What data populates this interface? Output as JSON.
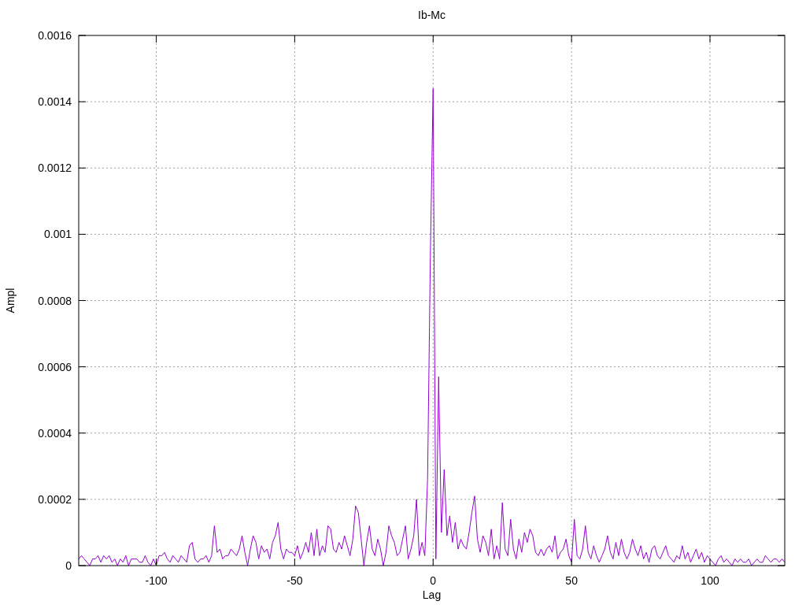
{
  "chart_data": {
    "type": "line",
    "grid": true,
    "title": "Ib-Mc",
    "xlabel": "Lag",
    "ylabel": "Ampl",
    "xlim": [
      -128,
      127
    ],
    "ylim": [
      0,
      0.0016
    ],
    "xticks": [
      -100,
      -50,
      0,
      50,
      100
    ],
    "yticks": [
      0,
      0.0002,
      0.0004,
      0.0006,
      0.0008,
      0.001,
      0.0012,
      0.0014,
      0.0016
    ],
    "x": [
      -128,
      -127,
      -126,
      -125,
      -124,
      -123,
      -122,
      -121,
      -120,
      -119,
      -118,
      -117,
      -116,
      -115,
      -114,
      -113,
      -112,
      -111,
      -110,
      -109,
      -108,
      -107,
      -106,
      -105,
      -104,
      -103,
      -102,
      -101,
      -100,
      -99,
      -98,
      -97,
      -96,
      -95,
      -94,
      -93,
      -92,
      -91,
      -90,
      -89,
      -88,
      -87,
      -86,
      -85,
      -84,
      -83,
      -82,
      -81,
      -80,
      -79,
      -78,
      -77,
      -76,
      -75,
      -74,
      -73,
      -72,
      -71,
      -70,
      -69,
      -68,
      -67,
      -66,
      -65,
      -64,
      -63,
      -62,
      -61,
      -60,
      -59,
      -58,
      -57,
      -56,
      -55,
      -54,
      -53,
      -52,
      -51,
      -50,
      -49,
      -48,
      -47,
      -46,
      -45,
      -44,
      -43,
      -42,
      -41,
      -40,
      -39,
      -38,
      -37,
      -36,
      -35,
      -34,
      -33,
      -32,
      -31,
      -30,
      -29,
      -28,
      -27,
      -26,
      -25,
      -24,
      -23,
      -22,
      -21,
      -20,
      -19,
      -18,
      -17,
      -16,
      -15,
      -14,
      -13,
      -12,
      -11,
      -10,
      -9,
      -8,
      -7,
      -6,
      -5,
      -4,
      -3,
      -2,
      -1,
      0,
      1,
      2,
      3,
      4,
      5,
      6,
      7,
      8,
      9,
      10,
      11,
      12,
      13,
      14,
      15,
      16,
      17,
      18,
      19,
      20,
      21,
      22,
      23,
      24,
      25,
      26,
      27,
      28,
      29,
      30,
      31,
      32,
      33,
      34,
      35,
      36,
      37,
      38,
      39,
      40,
      41,
      42,
      43,
      44,
      45,
      46,
      47,
      48,
      49,
      50,
      51,
      52,
      53,
      54,
      55,
      56,
      57,
      58,
      59,
      60,
      61,
      62,
      63,
      64,
      65,
      66,
      67,
      68,
      69,
      70,
      71,
      72,
      73,
      74,
      75,
      76,
      77,
      78,
      79,
      80,
      81,
      82,
      83,
      84,
      85,
      86,
      87,
      88,
      89,
      90,
      91,
      92,
      93,
      94,
      95,
      96,
      97,
      98,
      99,
      100,
      101,
      102,
      103,
      104,
      105,
      106,
      107,
      108,
      109,
      110,
      111,
      112,
      113,
      114,
      115,
      116,
      117,
      118,
      119,
      120,
      121,
      122,
      123,
      124,
      125,
      126,
      127
    ],
    "series": [
      {
        "color": "#9400d3",
        "values": [
          2e-05,
          3e-05,
          2e-05,
          1e-05,
          0,
          2e-05,
          2e-05,
          3e-05,
          1e-05,
          3e-05,
          2e-05,
          3e-05,
          1e-05,
          2e-05,
          0,
          2e-05,
          1e-05,
          3e-05,
          0,
          2e-05,
          2e-05,
          2e-05,
          1e-05,
          1e-05,
          3e-05,
          1e-05,
          0,
          2e-05,
          0,
          3e-05,
          3e-05,
          4e-05,
          2e-05,
          1e-05,
          3e-05,
          2e-05,
          1e-05,
          3e-05,
          2e-05,
          1e-05,
          6e-05,
          7e-05,
          2e-05,
          1e-05,
          2e-05,
          2e-05,
          3e-05,
          1e-05,
          3e-05,
          0.00012,
          4e-05,
          5e-05,
          2e-05,
          3e-05,
          3e-05,
          5e-05,
          4e-05,
          3e-05,
          5e-05,
          9e-05,
          4e-05,
          0,
          5e-05,
          9e-05,
          7e-05,
          2e-05,
          6e-05,
          4e-05,
          5e-05,
          2e-05,
          7e-05,
          9e-05,
          0.00013,
          5e-05,
          2e-05,
          5e-05,
          4e-05,
          4e-05,
          3e-05,
          6e-05,
          2e-05,
          4e-05,
          7e-05,
          4e-05,
          0.0001,
          3e-05,
          0.00011,
          3e-05,
          6e-05,
          4e-05,
          0.00012,
          0.00011,
          5e-05,
          4e-05,
          7e-05,
          5e-05,
          9e-05,
          6e-05,
          3e-05,
          8e-05,
          0.00018,
          0.00016,
          8e-05,
          0,
          7e-05,
          0.00012,
          5e-05,
          3e-05,
          8e-05,
          5e-05,
          0,
          4e-05,
          0.00012,
          9e-05,
          7e-05,
          3e-05,
          4e-05,
          8e-05,
          0.00012,
          2e-05,
          5e-05,
          9e-05,
          0.0002,
          3e-05,
          7e-05,
          3e-05,
          0.00026,
          0.00093,
          0.00144,
          2e-05,
          0.00057,
          0.0001,
          0.00029,
          9e-05,
          0.00015,
          7e-05,
          0.00013,
          5e-05,
          8e-05,
          6e-05,
          5e-05,
          0.0001,
          0.00016,
          0.00021,
          8e-05,
          4e-05,
          9e-05,
          7e-05,
          3e-05,
          0.00011,
          2e-05,
          6e-05,
          2e-05,
          0.00019,
          5e-05,
          3e-05,
          0.00014,
          5e-05,
          2e-05,
          8e-05,
          4e-05,
          0.0001,
          7e-05,
          0.00011,
          9e-05,
          4e-05,
          3e-05,
          5e-05,
          3e-05,
          5e-05,
          6e-05,
          4e-05,
          9e-05,
          2e-05,
          4e-05,
          5e-05,
          8e-05,
          3e-05,
          1e-05,
          0.00014,
          3e-05,
          2e-05,
          5e-05,
          0.00012,
          4e-05,
          2e-05,
          6e-05,
          3e-05,
          1e-05,
          3e-05,
          5e-05,
          9e-05,
          4e-05,
          2e-05,
          7e-05,
          3e-05,
          8e-05,
          4e-05,
          2e-05,
          4e-05,
          8e-05,
          5e-05,
          3e-05,
          6e-05,
          2e-05,
          4e-05,
          1e-05,
          5e-05,
          6e-05,
          3e-05,
          2e-05,
          4e-05,
          6e-05,
          3e-05,
          2e-05,
          1e-05,
          3e-05,
          2e-05,
          6e-05,
          2e-05,
          4e-05,
          1e-05,
          3e-05,
          5e-05,
          2e-05,
          4e-05,
          1e-05,
          3e-05,
          2e-05,
          1e-05,
          0,
          2e-05,
          3e-05,
          1e-05,
          2e-05,
          1e-05,
          0,
          2e-05,
          1e-05,
          2e-05,
          1e-05,
          1e-05,
          2e-05,
          0,
          1e-05,
          2e-05,
          1e-05,
          1e-05,
          3e-05,
          2e-05,
          1e-05,
          2e-05,
          2e-05,
          1e-05,
          2e-05,
          1e-05
        ]
      }
    ]
  }
}
